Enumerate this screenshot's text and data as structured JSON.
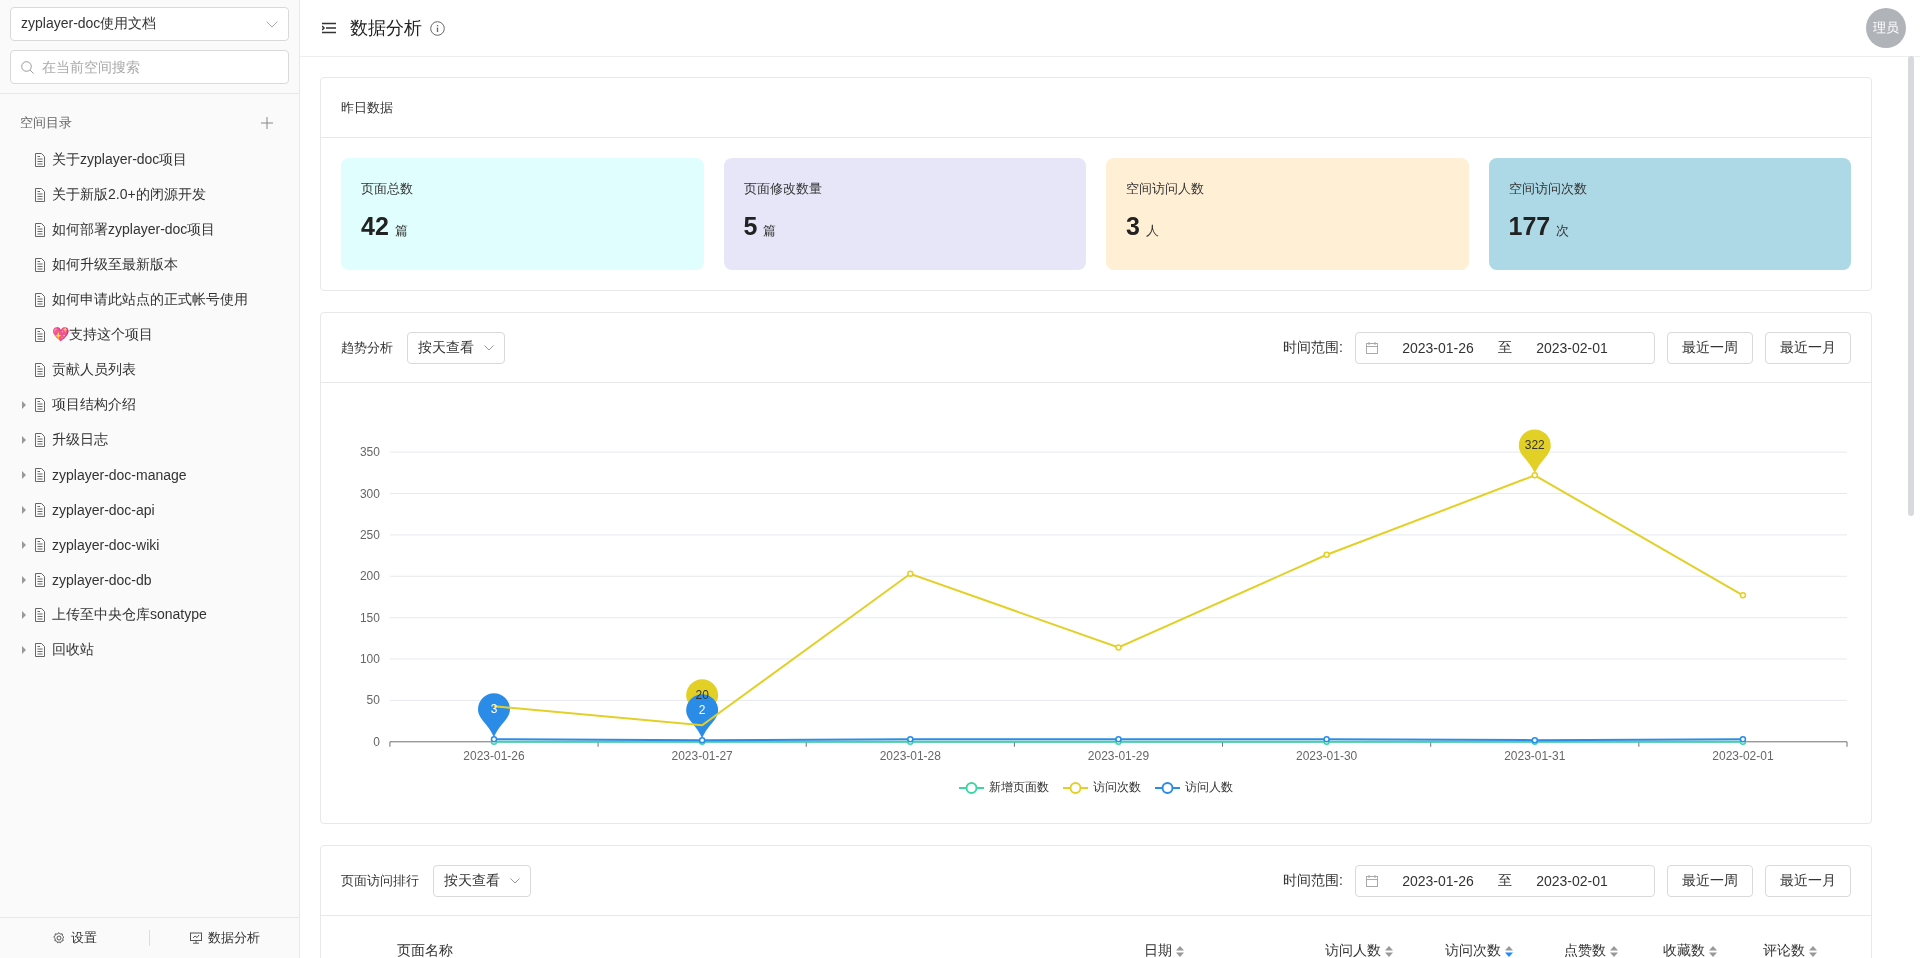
{
  "sidebar": {
    "space_select": {
      "value": "zyplayer-doc使用文档"
    },
    "search": {
      "placeholder": "在当前空间搜索"
    },
    "section_title": "空间目录",
    "items": [
      {
        "label": "关于zyplayer-doc项目",
        "expandable": false
      },
      {
        "label": "关于新版2.0+的闭源开发",
        "expandable": false
      },
      {
        "label": "如何部署zyplayer-doc项目",
        "expandable": false
      },
      {
        "label": "如何升级至最新版本",
        "expandable": false
      },
      {
        "label": "如何申请此站点的正式帐号使用",
        "expandable": false
      },
      {
        "label": "💖支持这个项目",
        "expandable": false
      },
      {
        "label": "贡献人员列表",
        "expandable": false
      },
      {
        "label": "项目结构介绍",
        "expandable": true
      },
      {
        "label": "升级日志",
        "expandable": true
      },
      {
        "label": "zyplayer-doc-manage",
        "expandable": true
      },
      {
        "label": "zyplayer-doc-api",
        "expandable": true
      },
      {
        "label": "zyplayer-doc-wiki",
        "expandable": true
      },
      {
        "label": "zyplayer-doc-db",
        "expandable": true
      },
      {
        "label": "上传至中央仓库sonatype",
        "expandable": true
      },
      {
        "label": "回收站",
        "expandable": true
      }
    ],
    "footer": [
      {
        "kind": "settings",
        "label": "设置"
      },
      {
        "kind": "analytics",
        "label": "数据分析"
      }
    ]
  },
  "header": {
    "title": "数据分析",
    "avatar": "理员"
  },
  "yesterday": {
    "title": "昨日数据",
    "cards": [
      {
        "label": "页面总数",
        "value": "42",
        "unit": "篇",
        "color": "#e0fefe"
      },
      {
        "label": "页面修改数量",
        "value": "5",
        "unit": "篇",
        "color": "#e6e6f8"
      },
      {
        "label": "空间访问人数",
        "value": "3",
        "unit": "人",
        "color": "#ffefd5"
      },
      {
        "label": "空间访问次数",
        "value": "177",
        "unit": "次",
        "color": "#add8e6"
      }
    ]
  },
  "trend": {
    "title": "趋势分析",
    "mode": "按天查看",
    "range_label": "时间范围:",
    "start": "2023-01-26",
    "to": "至",
    "end": "2023-02-01",
    "buttons": [
      "最近一周",
      "最近一月"
    ],
    "chart_data": {
      "type": "line",
      "categories": [
        "2023-01-26",
        "2023-01-27",
        "2023-01-28",
        "2023-01-29",
        "2023-01-30",
        "2023-01-31",
        "2023-02-01"
      ],
      "ylim": [
        0,
        350
      ],
      "yticks": [
        0,
        50,
        100,
        150,
        200,
        250,
        300,
        350
      ],
      "grid": true,
      "series": [
        {
          "name": "新增页面数",
          "color": "#3dd6a3",
          "marker": "circle",
          "values": [
            0,
            0,
            0,
            0,
            0,
            0,
            0
          ]
        },
        {
          "name": "访问次数",
          "color": "#e3d027",
          "marker": "circle",
          "values": [
            43,
            20,
            203,
            114,
            226,
            322,
            177
          ]
        },
        {
          "name": "访问人数",
          "color": "#2b8ce8",
          "marker": "circle",
          "values": [
            3,
            2,
            3,
            3,
            3,
            2,
            3
          ]
        }
      ],
      "annotations": [
        {
          "x": "2023-01-27",
          "y": 20,
          "text": "20"
        },
        {
          "x": "2023-01-31",
          "y": 322,
          "text": "322"
        },
        {
          "x": "2023-01-26",
          "y": 3,
          "text": "3"
        },
        {
          "x": "2023-01-27",
          "y": 2,
          "text": "2"
        }
      ]
    }
  },
  "ranking": {
    "title": "页面访问排行",
    "mode": "按天查看",
    "range_label": "时间范围:",
    "start": "2023-01-26",
    "to": "至",
    "end": "2023-02-01",
    "buttons": [
      "最近一周",
      "最近一月"
    ],
    "columns": [
      {
        "label": "页面名称"
      },
      {
        "label": "日期",
        "sortable": true,
        "sorted_descending": false
      },
      {
        "label": "访问人数",
        "sortable": true,
        "sorted_descending": false
      },
      {
        "label": "访问次数",
        "sortable": true,
        "sorted_descending": true
      },
      {
        "label": "点赞数",
        "sortable": true,
        "sorted_descending": false
      },
      {
        "label": "收藏数",
        "sortable": true,
        "sorted_descending": false
      },
      {
        "label": "评论数",
        "sortable": true,
        "sorted_descending": false
      }
    ]
  }
}
